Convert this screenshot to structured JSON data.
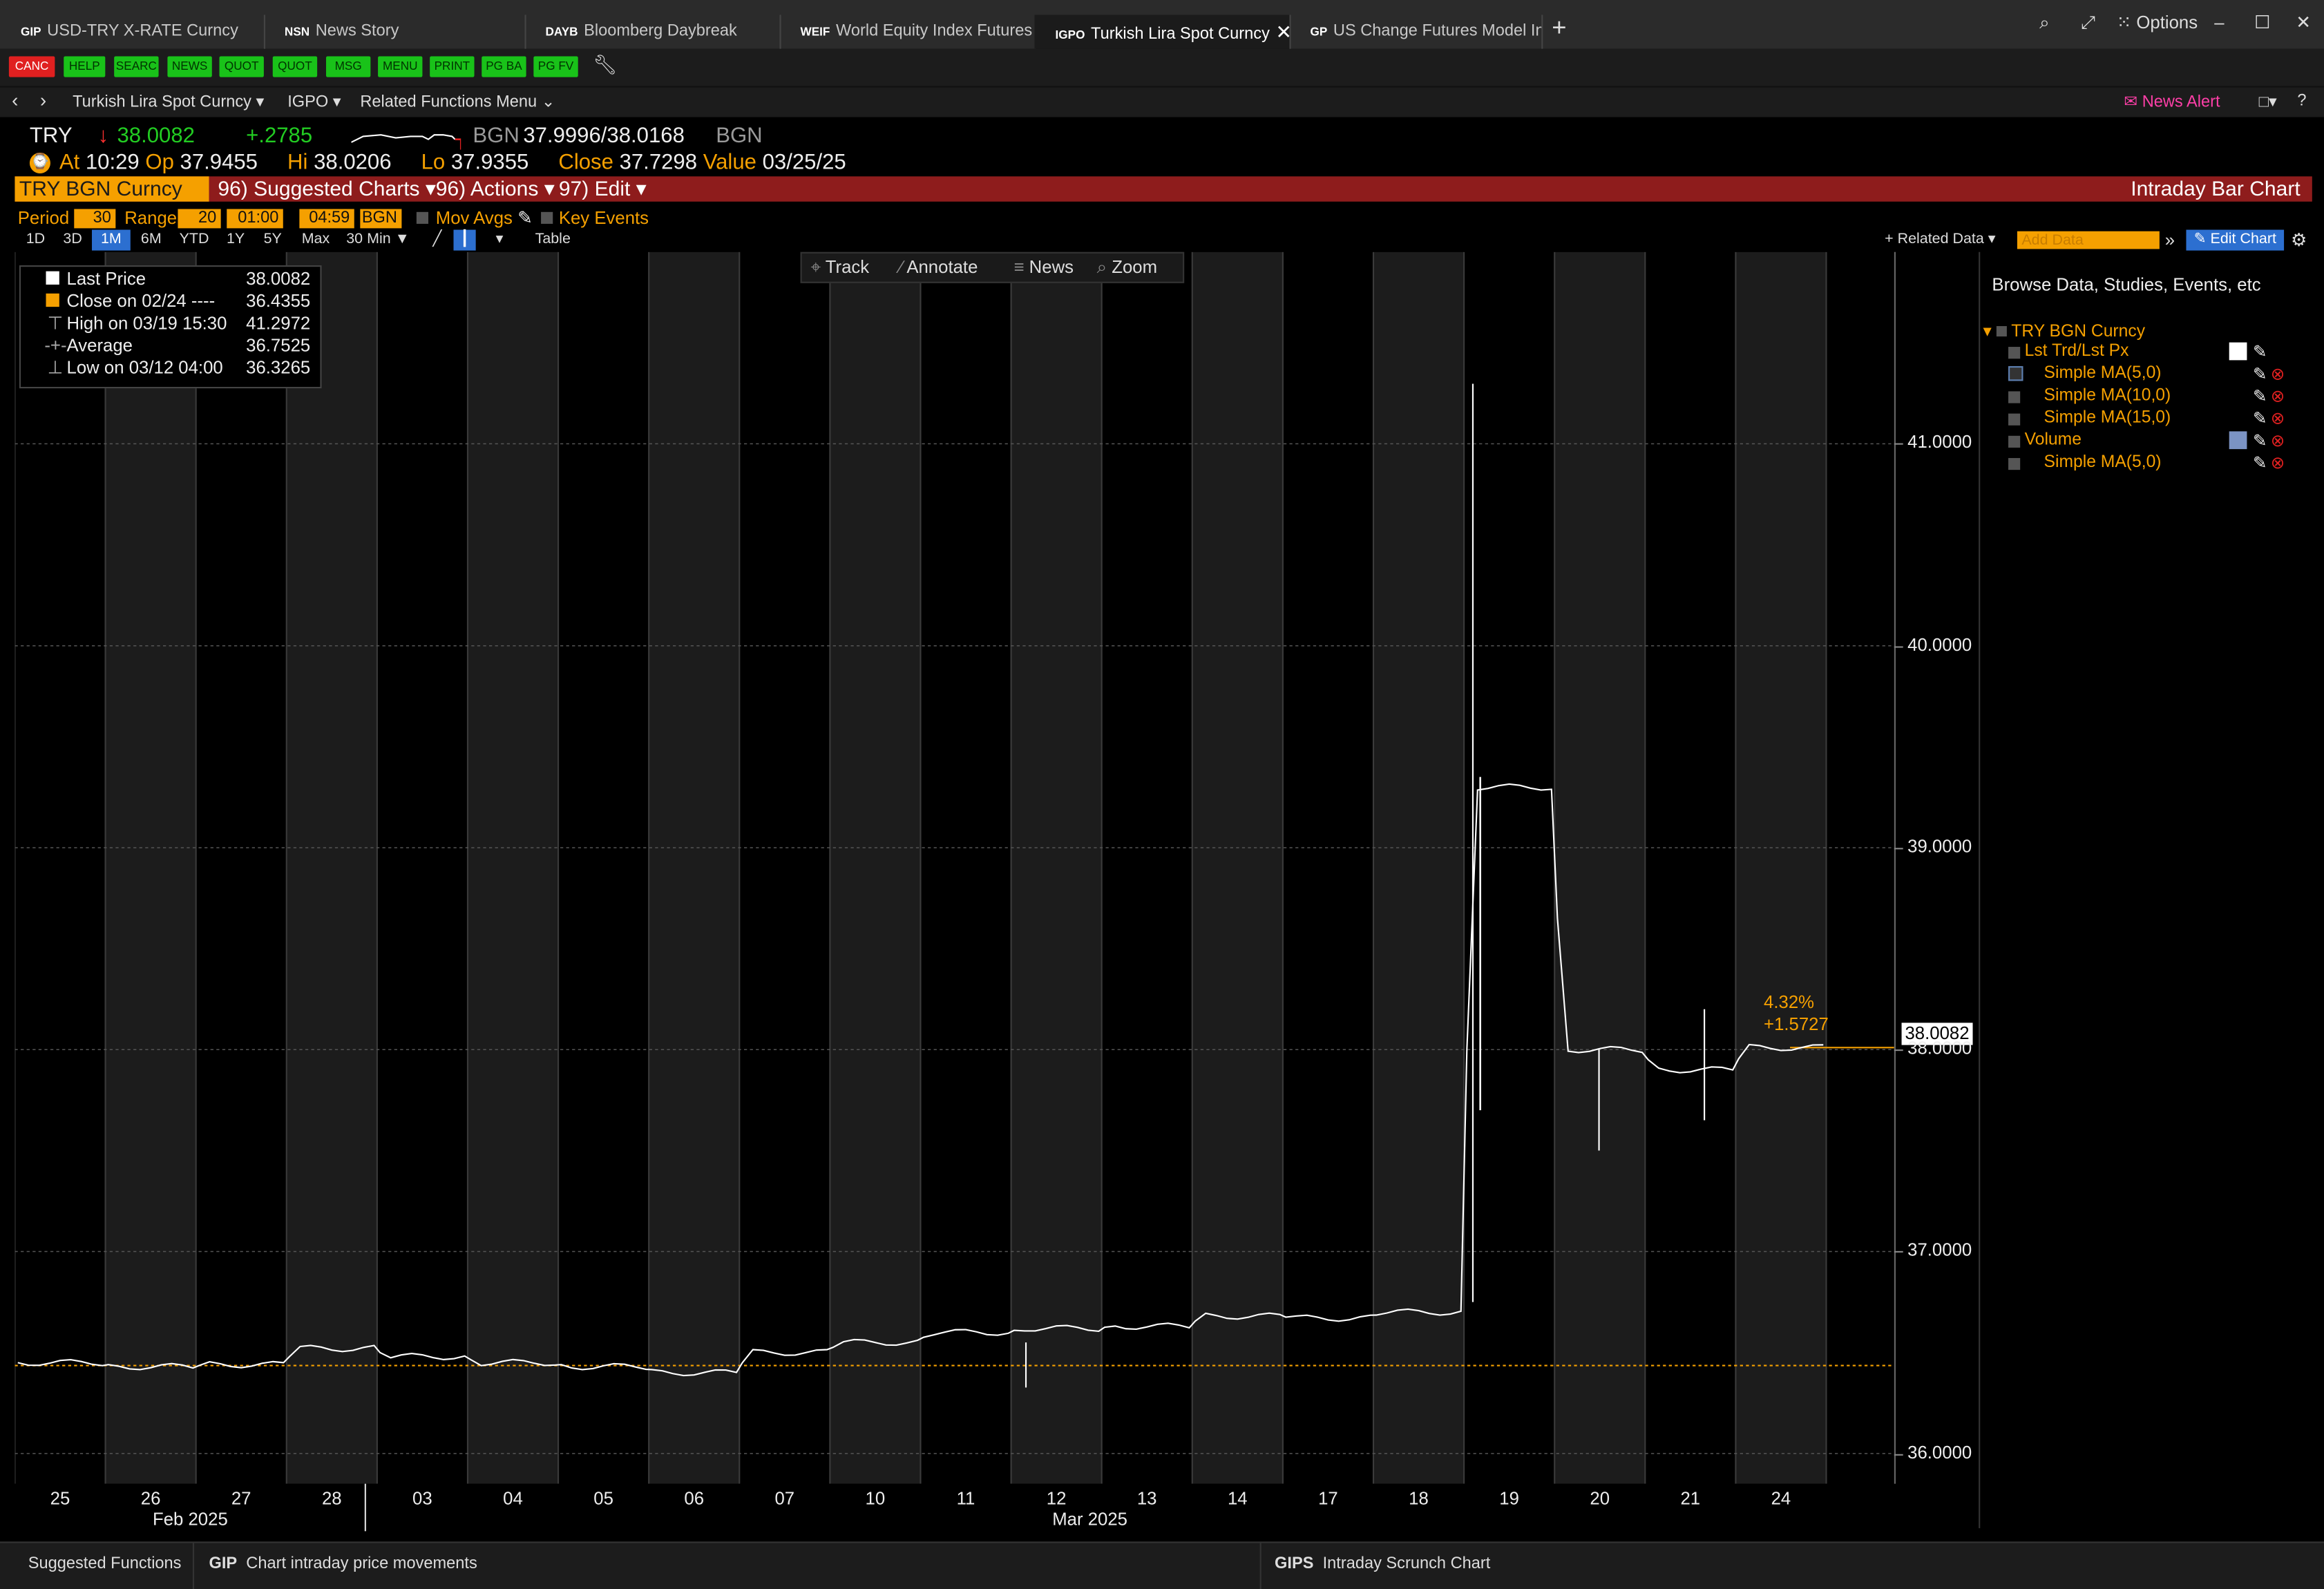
{
  "tabs": [
    {
      "code": "GIP",
      "label": "USD-TRY X-RATE Curncy"
    },
    {
      "code": "NSN",
      "label": "News Story"
    },
    {
      "code": "DAYB",
      "label": "Bloomberg Daybreak"
    },
    {
      "code": "WEIF",
      "label": "World Equity Index Futures"
    },
    {
      "code": "IGPO",
      "label": "Turkish Lira Spot Curncy"
    },
    {
      "code": "GP",
      "label": "US Change Futures Model In..."
    }
  ],
  "window": {
    "new_tab": "+",
    "options_label": "Options",
    "minimize": "–",
    "maximize": "☐",
    "close": "✕"
  },
  "keys": [
    "CANC",
    "HELP",
    "SEARC",
    "NEWS",
    "QUOT",
    "QUOT",
    "MSG",
    "MENU",
    "PRINT",
    "PG BA",
    "PG FV"
  ],
  "nav": {
    "security": "Turkish Lira Spot Curncy ▾",
    "function": "IGPO ▾",
    "related": "Related Functions Menu ⌄",
    "news_alert": "News Alert",
    "help": "?"
  },
  "quote": {
    "ticker": "TRY",
    "arrow": "↓",
    "last": "38.0082",
    "change": "+.2785",
    "bgn_label": "BGN",
    "bid_ask": "37.9996/38.0168",
    "bgn_label2": "BGN",
    "at_label": "At",
    "time": "10:29",
    "op_label": "Op",
    "open": "37.9455",
    "hi_label": "Hi",
    "high": "38.0206",
    "lo_label": "Lo",
    "low": "37.9355",
    "close_label": "Close",
    "close": "37.7298",
    "value_label": "Value",
    "value_date": "03/25/25"
  },
  "redbar": {
    "security": "TRY BGN Curncy",
    "suggested": "96) Suggested Charts ▾",
    "actions": "96) Actions ▾",
    "edit": "97) Edit ▾",
    "chart_title": "Intraday Bar Chart"
  },
  "options": {
    "period_label": "Period",
    "period": "30",
    "range_label": "Range",
    "range": "20",
    "start": "01:00",
    "end": "04:59",
    "source": "BGN",
    "mov_avgs": "Mov Avgs",
    "key_events": "Key Events"
  },
  "periods": [
    "1D",
    "3D",
    "1M",
    "6M",
    "YTD",
    "1Y",
    "5Y",
    "Max",
    "30 Min ▼"
  ],
  "selected_period": "1M",
  "table_label": "Table",
  "related_data": "+ Related Data ▾",
  "add_data_placeholder": "Add Data",
  "edit_chart": "Edit Chart",
  "chart_toolbar": [
    "Track",
    "Annotate",
    "News",
    "Zoom"
  ],
  "legend": [
    {
      "label": "Last Price",
      "value": "38.0082"
    },
    {
      "label": "Close on 02/24 ----",
      "value": "36.4355"
    },
    {
      "label": "High on 03/19 15:30",
      "value": "41.2972"
    },
    {
      "label": "Average",
      "value": "36.7525"
    },
    {
      "label": "Low on 03/12 04:00",
      "value": "36.3265"
    }
  ],
  "price_tag": "38.0082",
  "change_pct": "4.32%",
  "change_abs": "+1.5727",
  "month_labels": [
    "Feb 2025",
    "Mar 2025"
  ],
  "right_panel": {
    "header": "Browse Data, Studies, Events, etc",
    "security": "TRY BGN Curncy",
    "items": [
      "Lst Trd/Lst Px",
      "Simple MA(5,0)",
      "Simple MA(10,0)",
      "Simple MA(15,0)",
      "Volume",
      "Simple MA(5,0)"
    ]
  },
  "bottom": {
    "suggested": "Suggested Functions",
    "f1_code": "GIP",
    "f1_label": "Chart intraday price movements",
    "f2_code": "GIPS",
    "f2_label": "Intraday Scrunch Chart"
  },
  "colors": {
    "orange": "#f5a000",
    "green": "#22cc22",
    "red_bar": "#8e1c1c",
    "key_green": "#19c219",
    "line": "#ffffff"
  },
  "chart_data": {
    "type": "line",
    "x": [
      "25",
      "26",
      "27",
      "28",
      "03",
      "04",
      "05",
      "06",
      "07",
      "10",
      "11",
      "12",
      "13",
      "14",
      "17",
      "18",
      "19",
      "20",
      "21",
      "24"
    ],
    "series": [
      {
        "values": [
          36.45,
          36.43,
          36.44,
          36.52,
          36.48,
          36.45,
          36.43,
          36.4,
          36.5,
          36.55,
          36.6,
          36.62,
          36.63,
          36.68,
          36.67,
          36.7,
          39.3,
          38.0,
          37.9,
          38.01
        ]
      }
    ],
    "ylim": [
      35.85,
      41.95
    ],
    "yticks": [
      "36.0000",
      "37.0000",
      "38.0000",
      "39.0000",
      "40.0000",
      "41.0000"
    ],
    "reference_line": 36.4355,
    "grid": true
  }
}
